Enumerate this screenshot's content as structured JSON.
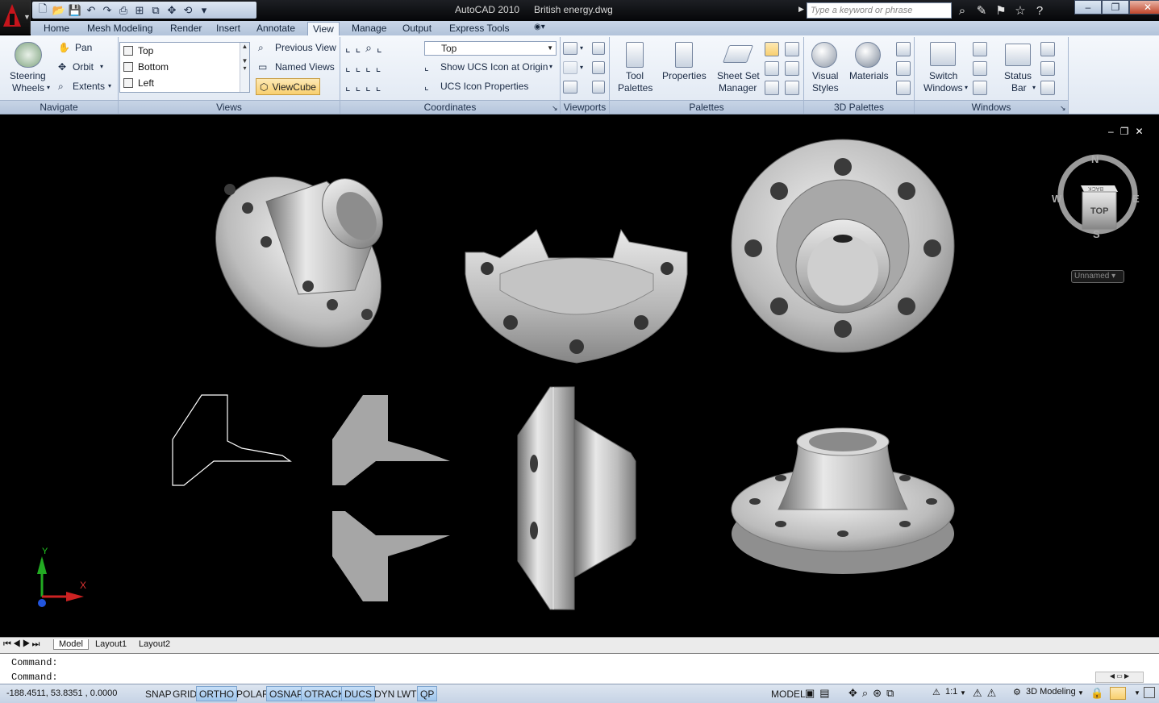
{
  "titlebar": {
    "app_title": "AutoCAD 2010",
    "document_title": "British energy.dwg",
    "search_placeholder": "Type a keyword or phrase"
  },
  "ribbon_tabs": [
    {
      "label": "Home"
    },
    {
      "label": "Mesh Modeling"
    },
    {
      "label": "Render"
    },
    {
      "label": "Insert"
    },
    {
      "label": "Annotate"
    },
    {
      "label": "View",
      "active": true
    },
    {
      "label": "Manage"
    },
    {
      "label": "Output"
    },
    {
      "label": "Express Tools"
    }
  ],
  "panels": {
    "navigate": {
      "title": "Navigate",
      "steering_wheels": "Steering",
      "steering_wheels_2": "Wheels",
      "pan": "Pan",
      "orbit": "Orbit",
      "extents": "Extents"
    },
    "views": {
      "title": "Views",
      "list": [
        "Top",
        "Bottom",
        "Left"
      ],
      "previous_view": "Previous View",
      "named_views": "Named Views",
      "viewcube": "ViewCube"
    },
    "coordinates": {
      "title": "Coordinates",
      "ucs_combo": "Top",
      "show_ucs_icon": "Show UCS Icon at Origin",
      "ucs_icon_properties": "UCS Icon Properties"
    },
    "viewports": {
      "title": "Viewports"
    },
    "palettes": {
      "title": "Palettes",
      "tool_palettes_1": "Tool",
      "tool_palettes_2": "Palettes",
      "properties": "Properties",
      "sheet_set_1": "Sheet Set",
      "sheet_set_2": "Manager"
    },
    "palettes3d": {
      "title": "3D Palettes",
      "visual_styles_1": "Visual",
      "visual_styles_2": "Styles",
      "materials": "Materials"
    },
    "windows": {
      "title": "Windows",
      "switch_1": "Switch",
      "switch_2": "Windows",
      "status_1": "Status",
      "status_2": "Bar"
    }
  },
  "viewcube": {
    "face": "TOP",
    "back": "BACK",
    "n": "N",
    "s": "S",
    "e": "E",
    "w": "W",
    "ucs_menu": "Unnamed"
  },
  "ucs_axes": {
    "x": "X",
    "y": "Y"
  },
  "layout_tabs": [
    "Model",
    "Layout1",
    "Layout2"
  ],
  "command_lines": [
    "Command:",
    "Command:"
  ],
  "status": {
    "coordinates": "-188.4511, 53.8351 , 0.0000",
    "toggles": [
      {
        "label": "SNAP",
        "on": false
      },
      {
        "label": "GRID",
        "on": false
      },
      {
        "label": "ORTHO",
        "on": true
      },
      {
        "label": "POLAR",
        "on": false
      },
      {
        "label": "OSNAP",
        "on": true
      },
      {
        "label": "OTRACK",
        "on": true
      },
      {
        "label": "DUCS",
        "on": true
      },
      {
        "label": "DYN",
        "on": false
      },
      {
        "label": "LWT",
        "on": false
      },
      {
        "label": "QP",
        "on": true
      }
    ],
    "model": "MODEL",
    "scale": "1:1",
    "workspace": "3D Modeling"
  },
  "colors": {
    "accent": "#f8cf6f",
    "ribbon_bg": "#e4ebf5",
    "viewport_bg": "#000000",
    "model_metal": "#b8b8b8"
  }
}
